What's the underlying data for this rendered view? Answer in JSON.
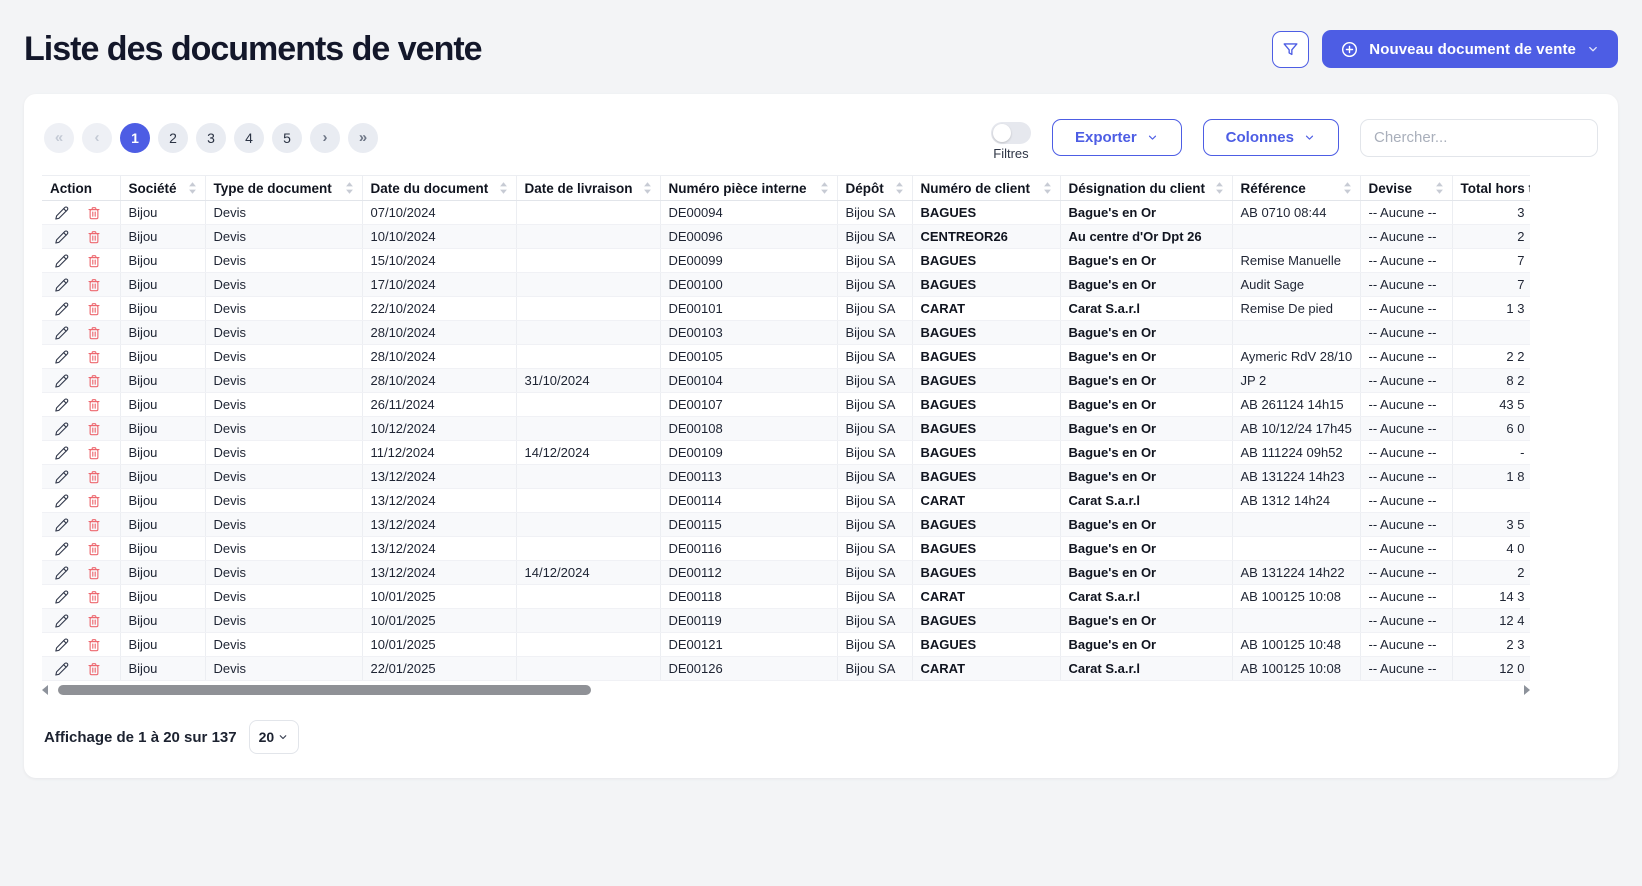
{
  "page": {
    "title": "Liste des documents de vente"
  },
  "colors": {
    "accent": "#4d5de4",
    "danger": "#ed686f",
    "background": "#f3f4f6",
    "active_page": "#4d5de4"
  },
  "header": {
    "filter_icon": "funnel-icon",
    "new_document_label": "Nouveau document de vente",
    "new_document_icons": [
      "plus-circle-icon",
      "chevron-down-icon"
    ]
  },
  "toolbar": {
    "filters_label": "Filtres",
    "filters_toggle_state": "off",
    "export_label": "Exporter",
    "columns_label": "Colonnes",
    "search_placeholder": "Chercher...",
    "search_value": ""
  },
  "pagination": {
    "first": "«",
    "prev": "‹",
    "next": "›",
    "last": "»",
    "pages": [
      "1",
      "2",
      "3",
      "4",
      "5"
    ],
    "active_page": "1",
    "first_prev_disabled": true
  },
  "table": {
    "columns": [
      {
        "label": "Action",
        "sortable": false
      },
      {
        "label": "Société",
        "sortable": true
      },
      {
        "label": "Type de document",
        "sortable": true
      },
      {
        "label": "Date du document",
        "sortable": true
      },
      {
        "label": "Date de livraison",
        "sortable": true
      },
      {
        "label": "Numéro pièce interne",
        "sortable": true
      },
      {
        "label": "Dépôt",
        "sortable": true
      },
      {
        "label": "Numéro de client",
        "sortable": true
      },
      {
        "label": "Désignation du client",
        "sortable": true
      },
      {
        "label": "Référence",
        "sortable": true
      },
      {
        "label": "Devise",
        "sortable": true
      },
      {
        "label": "Total hors taxe",
        "sortable": true
      }
    ],
    "row_actions": [
      {
        "name": "edit",
        "icon": "pencil-icon"
      },
      {
        "name": "delete",
        "icon": "trash-icon"
      }
    ],
    "rows": [
      [
        "Bijou",
        "Devis",
        "07/10/2024",
        "",
        "DE00094",
        "Bijou SA",
        "BAGUES",
        "Bague's en Or",
        "AB 0710 08:44",
        "-- Aucune --",
        "3"
      ],
      [
        "Bijou",
        "Devis",
        "10/10/2024",
        "",
        "DE00096",
        "Bijou SA",
        "CENTREOR26",
        "Au centre d'Or Dpt 26",
        "",
        "-- Aucune --",
        "2"
      ],
      [
        "Bijou",
        "Devis",
        "15/10/2024",
        "",
        "DE00099",
        "Bijou SA",
        "BAGUES",
        "Bague's en Or",
        "Remise Manuelle",
        "-- Aucune --",
        "7"
      ],
      [
        "Bijou",
        "Devis",
        "17/10/2024",
        "",
        "DE00100",
        "Bijou SA",
        "BAGUES",
        "Bague's en Or",
        "Audit Sage",
        "-- Aucune --",
        "7"
      ],
      [
        "Bijou",
        "Devis",
        "22/10/2024",
        "",
        "DE00101",
        "Bijou SA",
        "CARAT",
        "Carat S.a.r.l",
        "Remise De pied",
        "-- Aucune --",
        "1 3"
      ],
      [
        "Bijou",
        "Devis",
        "28/10/2024",
        "",
        "DE00103",
        "Bijou SA",
        "BAGUES",
        "Bague's en Or",
        "",
        "-- Aucune --",
        ""
      ],
      [
        "Bijou",
        "Devis",
        "28/10/2024",
        "",
        "DE00105",
        "Bijou SA",
        "BAGUES",
        "Bague's en Or",
        "Aymeric RdV 28/10",
        "-- Aucune --",
        "2 2"
      ],
      [
        "Bijou",
        "Devis",
        "28/10/2024",
        "31/10/2024",
        "DE00104",
        "Bijou SA",
        "BAGUES",
        "Bague's en Or",
        "JP 2",
        "-- Aucune --",
        "8 2"
      ],
      [
        "Bijou",
        "Devis",
        "26/11/2024",
        "",
        "DE00107",
        "Bijou SA",
        "BAGUES",
        "Bague's en Or",
        "AB 261124 14h15",
        "-- Aucune --",
        "43 5"
      ],
      [
        "Bijou",
        "Devis",
        "10/12/2024",
        "",
        "DE00108",
        "Bijou SA",
        "BAGUES",
        "Bague's en Or",
        "AB 10/12/24 17h45",
        "-- Aucune --",
        "6 0"
      ],
      [
        "Bijou",
        "Devis",
        "11/12/2024",
        "14/12/2024",
        "DE00109",
        "Bijou SA",
        "BAGUES",
        "Bague's en Or",
        "AB 111224 09h52",
        "-- Aucune --",
        "-"
      ],
      [
        "Bijou",
        "Devis",
        "13/12/2024",
        "",
        "DE00113",
        "Bijou SA",
        "BAGUES",
        "Bague's en Or",
        "AB 131224 14h23",
        "-- Aucune --",
        "1 8"
      ],
      [
        "Bijou",
        "Devis",
        "13/12/2024",
        "",
        "DE00114",
        "Bijou SA",
        "CARAT",
        "Carat S.a.r.l",
        "AB 1312 14h24",
        "-- Aucune --",
        ""
      ],
      [
        "Bijou",
        "Devis",
        "13/12/2024",
        "",
        "DE00115",
        "Bijou SA",
        "BAGUES",
        "Bague's en Or",
        "",
        "-- Aucune --",
        "3 5"
      ],
      [
        "Bijou",
        "Devis",
        "13/12/2024",
        "",
        "DE00116",
        "Bijou SA",
        "BAGUES",
        "Bague's en Or",
        "",
        "-- Aucune --",
        "4 0"
      ],
      [
        "Bijou",
        "Devis",
        "13/12/2024",
        "14/12/2024",
        "DE00112",
        "Bijou SA",
        "BAGUES",
        "Bague's en Or",
        "AB 131224 14h22",
        "-- Aucune --",
        "2"
      ],
      [
        "Bijou",
        "Devis",
        "10/01/2025",
        "",
        "DE00118",
        "Bijou SA",
        "CARAT",
        "Carat S.a.r.l",
        "AB 100125 10:08",
        "-- Aucune --",
        "14 3"
      ],
      [
        "Bijou",
        "Devis",
        "10/01/2025",
        "",
        "DE00119",
        "Bijou SA",
        "BAGUES",
        "Bague's en Or",
        "",
        "-- Aucune --",
        "12 4"
      ],
      [
        "Bijou",
        "Devis",
        "10/01/2025",
        "",
        "DE00121",
        "Bijou SA",
        "BAGUES",
        "Bague's en Or",
        "AB 100125 10:48",
        "-- Aucune --",
        "2 3"
      ],
      [
        "Bijou",
        "Devis",
        "22/01/2025",
        "",
        "DE00126",
        "Bijou SA",
        "CARAT",
        "Carat S.a.r.l",
        "AB 100125 10:08",
        "-- Aucune --",
        "12 0"
      ]
    ]
  },
  "footer": {
    "summary": "Affichage de 1 à 20 sur 137",
    "page_size": "20"
  }
}
